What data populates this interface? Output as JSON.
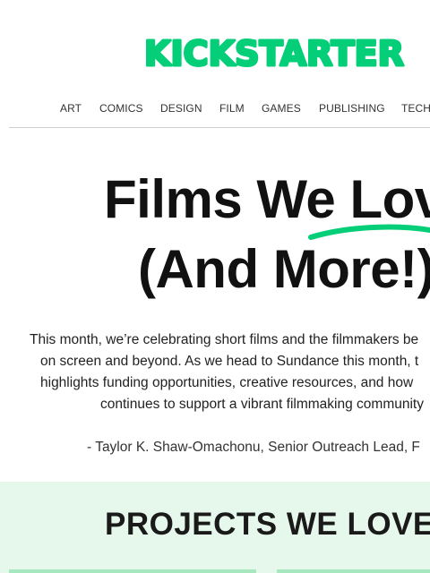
{
  "brand": {
    "logo_text": "KICKSTARTER",
    "color": "#05ce78"
  },
  "nav": {
    "items": [
      {
        "label": "ART"
      },
      {
        "label": "COMICS"
      },
      {
        "label": "DESIGN"
      },
      {
        "label": "FILM"
      },
      {
        "label": "GAMES"
      },
      {
        "label": "PUBLISHING"
      },
      {
        "label": "TECH"
      }
    ]
  },
  "hero": {
    "line1_prefix": "Films We ",
    "line1_highlight": "Love",
    "line2": "(And More!)",
    "underline_color": "#05ce78"
  },
  "intro": {
    "lines": [
      "This month, we’re celebrating short films and the filmmakers be",
      "on screen and beyond. As we head to Sundance this month, t",
      "highlights funding opportunities, creative resources, and how",
      "continues to support a vibrant filmmaking community"
    ],
    "attribution": "- Taylor K. Shaw-Omachonu, Senior Outreach Lead, F"
  },
  "projects": {
    "heading": "PROJECTS WE LOVE",
    "band_color": "#e6f8ec"
  }
}
